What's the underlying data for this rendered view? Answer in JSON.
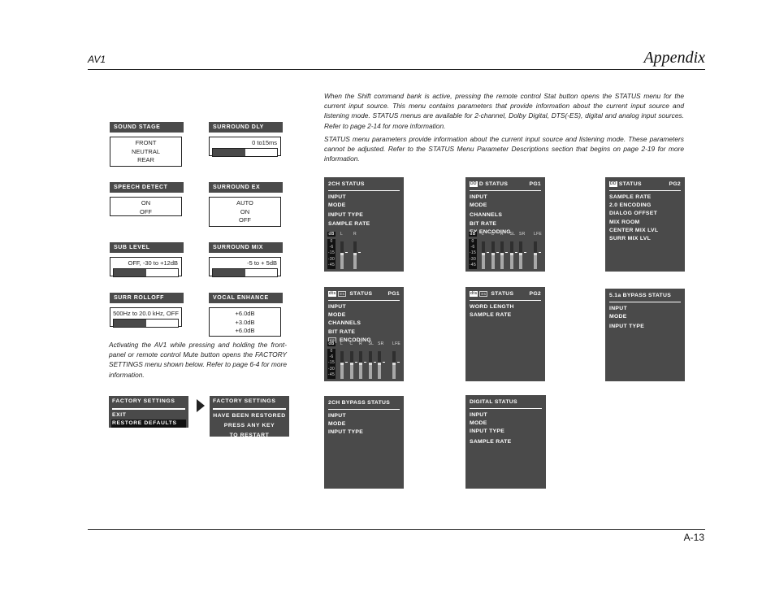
{
  "header": {
    "left": "AV1",
    "right": "Appendix"
  },
  "footer": {
    "page_number": "A-13"
  },
  "settings": {
    "sound_stage": {
      "label": "SOUND  STAGE",
      "options": [
        "FRONT",
        "NEUTRAL",
        "REAR"
      ]
    },
    "surround_dly": {
      "label": "SURROUND  DLY",
      "range": "0 to15ms",
      "fill_fraction": 0.5
    },
    "speech_detect": {
      "label": "SPEECH  DETECT",
      "options": [
        "ON",
        "OFF"
      ]
    },
    "surround_ex": {
      "label": "SURROUND  EX",
      "options": [
        "AUTO",
        "ON",
        "OFF"
      ]
    },
    "sub_level": {
      "label": "SUB  LEVEL",
      "range": "OFF, -30 to +12dB",
      "fill_fraction": 0.5
    },
    "surround_mix": {
      "label": "SURROUND  MIX",
      "range": "-5 to + 5dB",
      "fill_fraction": 0.5
    },
    "surr_rolloff": {
      "label": "SURR  ROLLOFF",
      "range": "500Hz to 20.0 kHz, OFF",
      "fill_fraction": 0.5
    },
    "vocal_enhance": {
      "label": "VOCAL  ENHANCE",
      "options": [
        "+6.0dB",
        "+3.0dB",
        "+6.0dB"
      ]
    }
  },
  "factory_paragraph": "Activating the AV1 while pressing and holding the front-panel or remote control Mute button opens the FACTORY SETTINGS menu shown below. Refer to page 6-4 for more information.",
  "factory_menu": {
    "title": "FACTORY  SETTINGS",
    "items": [
      "EXIT",
      "RESTORE  DEFAULTS"
    ],
    "selected": "RESTORE  DEFAULTS"
  },
  "factory_result": {
    "title": "FACTORY  SETTINGS",
    "lines": [
      "HAVE   BEEN  RESTORED",
      "PRESS  ANY KEY",
      "TO  RESTART"
    ]
  },
  "intro_paragraphs": [
    "When the Shift command bank is active, pressing the remote control Stat button opens the STATUS menu for the current input source. This menu contains parameters that provide information about the current input source and listening mode. STATUS menus are available for 2-channel, Dolby Digital, DTS(-ES), digital and analog input sources. Refer to page 2-14 for more information.",
    "STATUS menu parameters provide information about the current input source and listening mode. These parameters cannot be adjusted. Refer to the STATUS Menu Parameter Descriptions section that begins on page 2-19 for more information."
  ],
  "meter": {
    "db_label": "dB",
    "scale": [
      "0",
      "-6",
      "-15",
      "-30",
      "-45"
    ]
  },
  "status_screens": {
    "two_ch": {
      "title": "2CH STATUS",
      "page": "",
      "items": [
        "INPUT",
        "MODE",
        "INPUT TYPE",
        "SAMPLE RATE"
      ],
      "channels": [
        "L",
        "R"
      ]
    },
    "dolby_pg1": {
      "logo": "DD",
      "title": "D STATUS",
      "page": "PG1",
      "items": [
        "INPUT",
        "MODE",
        "CHANNELS",
        "BIT RATE",
        "EX ENCODING"
      ],
      "channels": [
        "L",
        "C",
        "R",
        "SL",
        "SR",
        "LFE"
      ]
    },
    "dolby_pg2": {
      "logo": "DD",
      "title": "STATUS",
      "page": "PG2",
      "items": [
        "SAMPLE RATE",
        "2.0 ENCODING",
        "DIALOG OFFSET",
        "MIX ROOM",
        "CENTER MIX LVL",
        "SURR MIX LVL"
      ]
    },
    "dts_pg1": {
      "logo": "dts",
      "logo2": "ES",
      "title": "STATUS",
      "page": "PG1",
      "items": [
        "INPUT",
        "MODE",
        "CHANNELS",
        "BIT RATE"
      ],
      "encoding_icon": "ES",
      "encoding_label": "ENCODING",
      "channels": [
        "L",
        "C",
        "R",
        "SL",
        "SR",
        "LFE"
      ]
    },
    "dts_pg2": {
      "logo": "dts",
      "logo2": "ES",
      "title": "STATUS",
      "page": "PG2",
      "items": [
        "WORD LENGTH",
        "SAMPLE RATE"
      ]
    },
    "bypass_51": {
      "title": "5.1a  BYPASS STATUS",
      "page": "",
      "items": [
        "INPUT",
        "MODE",
        "INPUT TYPE"
      ]
    },
    "bypass_2ch": {
      "title": "2CH BYPASS STATUS",
      "page": "",
      "items": [
        "INPUT",
        "MODE",
        "INPUT TYPE"
      ]
    },
    "digital": {
      "title": "DIGITAL STATUS",
      "page": "",
      "items": [
        "INPUT",
        "MODE",
        "INPUT TYPE",
        "SAMPLE RATE"
      ]
    }
  }
}
